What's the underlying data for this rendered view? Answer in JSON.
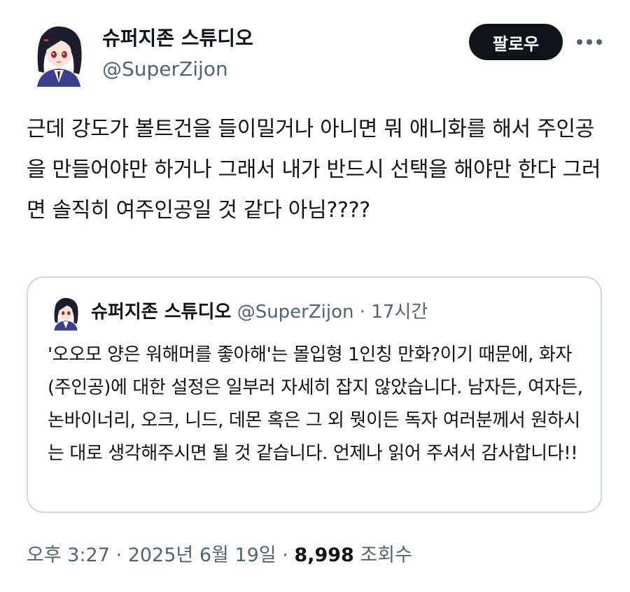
{
  "author": {
    "display_name": "슈퍼지존 스튜디오",
    "handle": "@SuperZijon",
    "avatar_icon": "anime-girl-avatar-icon"
  },
  "actions": {
    "follow_label": "팔로우",
    "more_icon": "more-horizontal-icon"
  },
  "tweet": {
    "text": "근데 강도가 볼트건을 들이밀거나 아니면 뭐 애니화를 해서 주인공을 만들어야만 하거나 그래서 내가 반드시 선택을 해야만 한다 그러면 솔직히 여주인공일 것 같다 아님????"
  },
  "quote": {
    "display_name": "슈퍼지존 스튜디오",
    "handle": "@SuperZijon",
    "separator": "·",
    "time": "17시간",
    "text": "'오오모 양은 워해머를 좋아해'는 몰입형 1인칭 만화?이기 때문에, 화자(주인공)에 대한 설정은 일부러 자세히 잡지 않았습니다. 남자든, 여자든, 논바이너리, 오크, 니드, 데몬 혹은 그 외 뭣이든 독자 여러분께서 원하시는 대로 생각해주시면 될 것 같습니다. 언제나 읽어 주셔서 감사합니다!!"
  },
  "meta": {
    "time": "오후 3:27",
    "separator": "·",
    "date": "2025년 6월 19일",
    "views_count": "8,998",
    "views_label": "조회수"
  },
  "colors": {
    "text_primary": "#0f1419",
    "text_secondary": "#536471",
    "border": "#cfd9de",
    "follow_bg": "#0f1419"
  }
}
